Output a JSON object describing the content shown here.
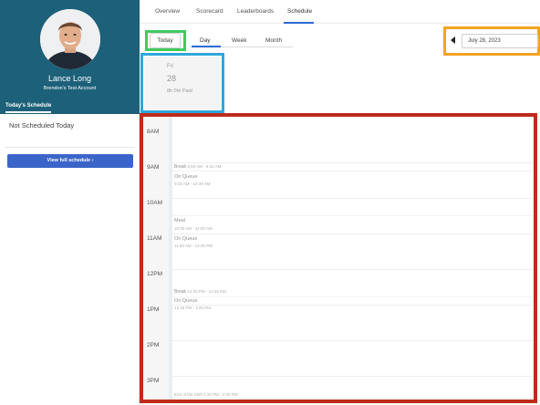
{
  "profile": {
    "name": "Lance Long",
    "account": "Brendon's Test Account",
    "tab": "Today's Schedule"
  },
  "left": {
    "status": "Not Scheduled Today",
    "full_schedule_button": "View full schedule ›"
  },
  "nav": {
    "tabs": [
      {
        "label": "Overview"
      },
      {
        "label": "Scorecard"
      },
      {
        "label": "Leaderboards"
      },
      {
        "label": "Schedule"
      }
    ],
    "active": "Schedule"
  },
  "toolbar": {
    "today_label": "Today",
    "views": [
      {
        "label": "Day"
      },
      {
        "label": "Week"
      },
      {
        "label": "Month"
      }
    ],
    "active_view": "Day",
    "date_value": "July 28, 2023"
  },
  "day_card": {
    "weekday": "Fri",
    "day": "28",
    "paid": "8h 0m Paid"
  },
  "schedule": {
    "hours": [
      "8AM",
      "9AM",
      "10AM",
      "11AM",
      "12PM",
      "1PM",
      "2PM",
      "3PM"
    ],
    "events": [
      {
        "title": "Break",
        "time": "9:00 AM - 9:15 AM"
      },
      {
        "title": "On Queue",
        "time": "9:15 AM - 10:30 AM"
      },
      {
        "title": "Meal",
        "time": "10:30 AM - 11:00 AM"
      },
      {
        "title": "On Queue",
        "time": "11:00 AM - 12:30 PM"
      },
      {
        "title": "Break",
        "time": "12:30 PM - 12:45 PM"
      },
      {
        "title": "On Queue",
        "time": "12:45 PM - 3:25 PM"
      },
      {
        "title": "End of the Shift",
        "time": "3:25 PM - 3:30 PM"
      }
    ]
  },
  "colors": {
    "profile_bg": "#1d6079",
    "accent_blue": "#2b6ad6",
    "button_blue": "#3a64c8",
    "highlight_green": "#3ecb5e",
    "highlight_orange": "#f5a324",
    "highlight_cyan": "#2ea7db",
    "highlight_red": "#bf2b1a"
  }
}
